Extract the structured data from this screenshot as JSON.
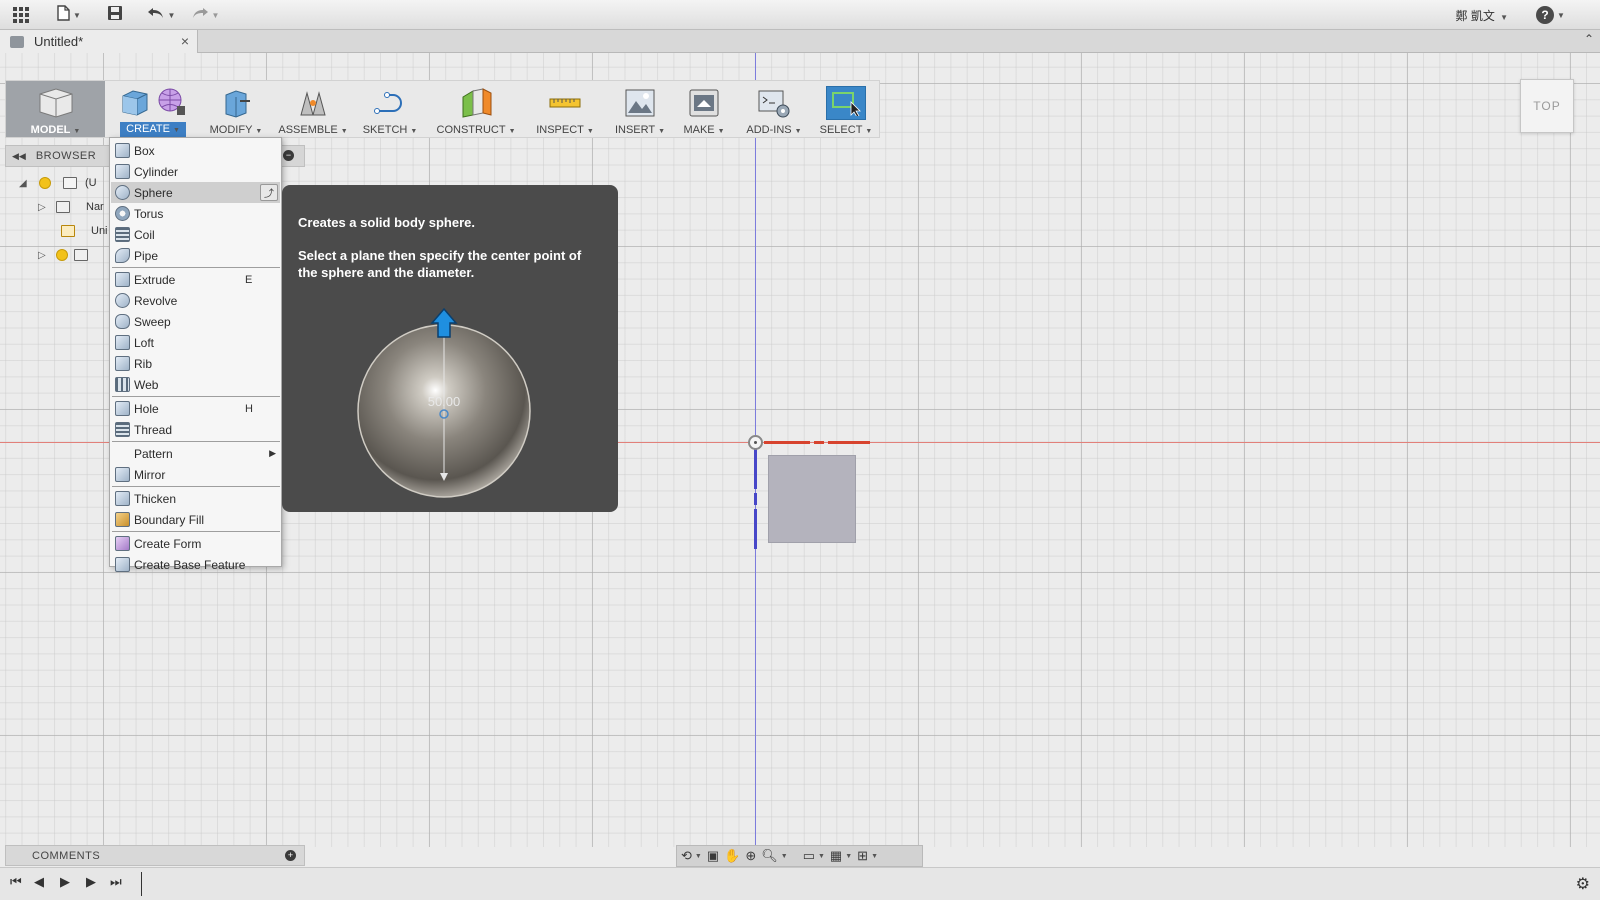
{
  "appbar": {
    "grid_icon": "grid-apps-icon",
    "file_icon": "file-icon",
    "save_icon": "save-icon",
    "undo_icon": "undo-icon",
    "redo_icon": "redo-icon",
    "user_name": "鄭 凱文",
    "help_label": "?"
  },
  "tabbar": {
    "doc_title": "Untitled*",
    "close_label": "×",
    "collapse_label": "⌃"
  },
  "toolbar": {
    "groups": [
      {
        "id": "model",
        "label": "MODEL"
      },
      {
        "id": "create",
        "label": "CREATE"
      },
      {
        "id": "modify",
        "label": "MODIFY"
      },
      {
        "id": "assemble",
        "label": "ASSEMBLE"
      },
      {
        "id": "sketch",
        "label": "SKETCH"
      },
      {
        "id": "construct",
        "label": "CONSTRUCT"
      },
      {
        "id": "inspect",
        "label": "INSPECT"
      },
      {
        "id": "insert",
        "label": "INSERT"
      },
      {
        "id": "make",
        "label": "MAKE"
      },
      {
        "id": "addins",
        "label": "ADD-INS"
      },
      {
        "id": "select",
        "label": "SELECT"
      }
    ]
  },
  "browser": {
    "title": "BROWSER",
    "rows": [
      {
        "label": "(U"
      },
      {
        "label": "Nar"
      },
      {
        "label": "Uni"
      }
    ]
  },
  "create_menu": {
    "items": [
      {
        "label": "Box",
        "key": ""
      },
      {
        "label": "Cylinder",
        "key": ""
      },
      {
        "label": "Sphere",
        "key": "",
        "highlighted": true
      },
      {
        "label": "Torus",
        "key": ""
      },
      {
        "label": "Coil",
        "key": ""
      },
      {
        "label": "Pipe",
        "key": ""
      },
      {
        "label": "Extrude",
        "key": "E"
      },
      {
        "label": "Revolve",
        "key": ""
      },
      {
        "label": "Sweep",
        "key": ""
      },
      {
        "label": "Loft",
        "key": ""
      },
      {
        "label": "Rib",
        "key": ""
      },
      {
        "label": "Web",
        "key": ""
      },
      {
        "label": "Hole",
        "key": "H"
      },
      {
        "label": "Thread",
        "key": ""
      },
      {
        "label": "Pattern",
        "key": "",
        "submenu": true
      },
      {
        "label": "Mirror",
        "key": ""
      },
      {
        "label": "Thicken",
        "key": ""
      },
      {
        "label": "Boundary Fill",
        "key": ""
      },
      {
        "label": "Create Form",
        "key": ""
      },
      {
        "label": "Create Base Feature",
        "key": ""
      }
    ]
  },
  "tooltip": {
    "title": "Creates a solid body sphere.",
    "description": "Select a plane then specify the center point of the sphere and the diameter.",
    "dimension_value": "50.00"
  },
  "viewcube": {
    "label": "TOP"
  },
  "comments": {
    "title": "COMMENTS",
    "add_label": "+"
  },
  "navbar": {
    "icons": [
      "orbit-icon",
      "look-at-icon",
      "pan-icon",
      "zoom-fit-icon",
      "zoom-window-icon",
      "display-settings-icon",
      "grid-settings-icon",
      "viewports-icon"
    ]
  },
  "timeline": {
    "icons": [
      "go-to-start-icon",
      "step-back-icon",
      "play-icon",
      "step-forward-icon",
      "go-to-end-icon"
    ],
    "settings_icon": "gear-icon"
  },
  "colors": {
    "accent_blue": "#3d7fc4",
    "x_axis": "#d7432e",
    "y_axis": "#4747c8",
    "tooltip_bg": "#4b4b4b"
  }
}
